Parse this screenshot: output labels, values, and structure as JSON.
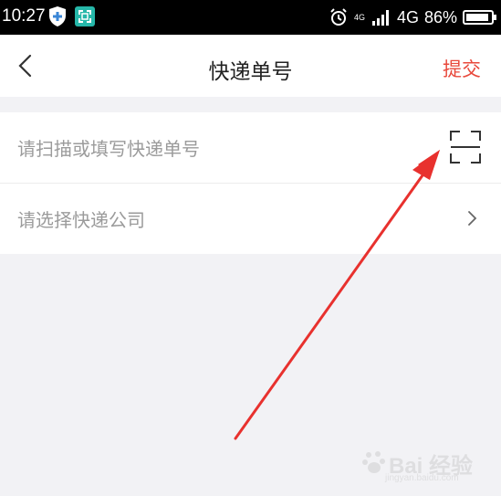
{
  "status_bar": {
    "time": "10:27",
    "network_small": "4G",
    "network": "4G",
    "battery": "86%",
    "icons": [
      "shield-icon",
      "scan-app-icon",
      "alarm-icon",
      "signal-icon",
      "battery-icon"
    ]
  },
  "nav": {
    "title": "快递单号",
    "submit_label": "提交",
    "back_icon": "chevron-left-icon"
  },
  "form": {
    "tracking_placeholder": "请扫描或填写快递单号",
    "company_placeholder": "请选择快递公司",
    "scan_icon": "scan-icon",
    "chevron_icon": "chevron-right-icon"
  },
  "watermark": {
    "text": "Bai 经验",
    "sub": "jingyan.baidu.com"
  },
  "colors": {
    "accent": "#e8483b",
    "arrow": "#e8312e",
    "background": "#f2f2f5",
    "placeholder": "#9b9b9b"
  }
}
